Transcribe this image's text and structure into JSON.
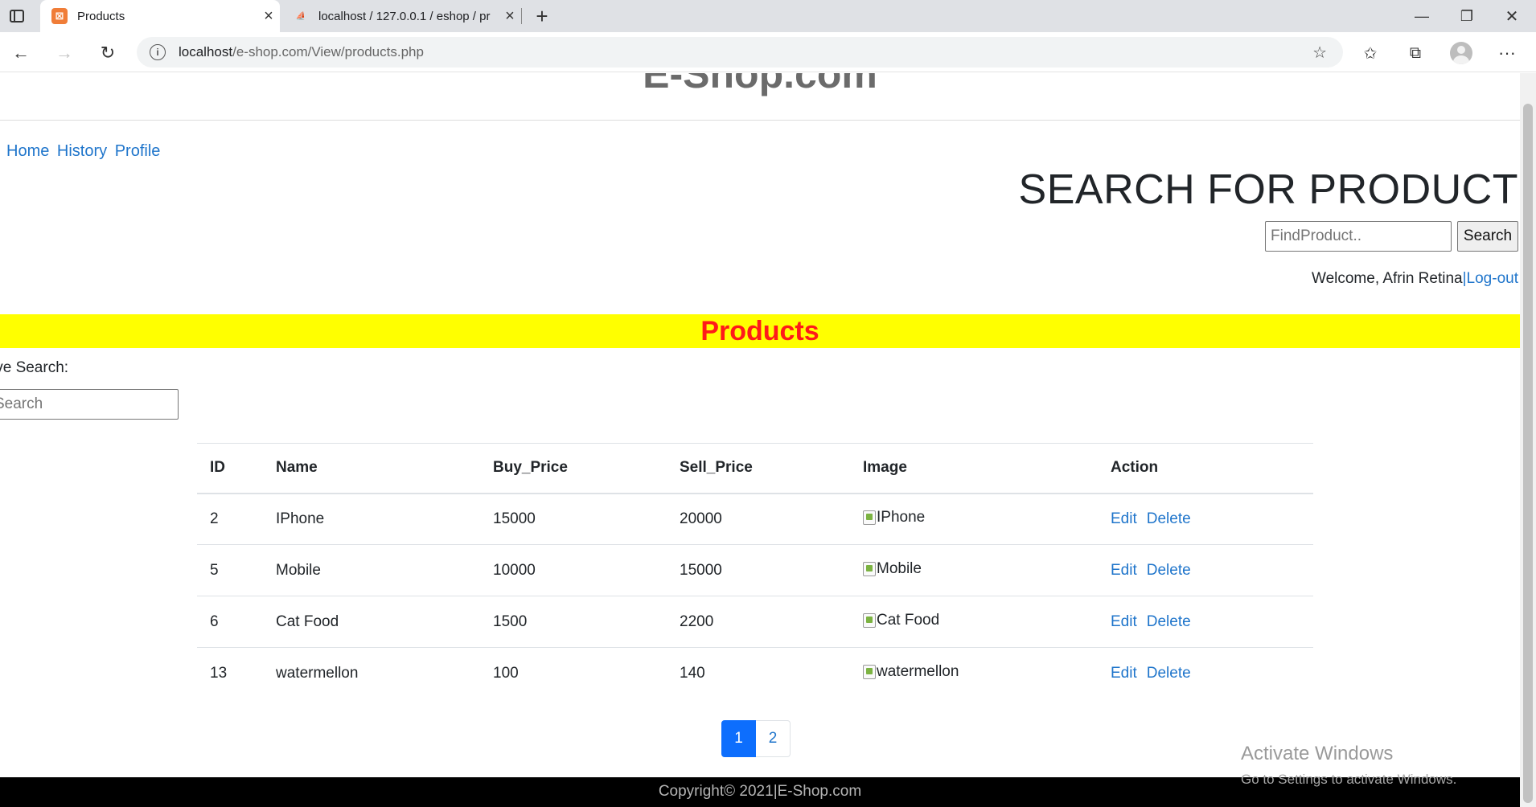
{
  "browser": {
    "tabs": [
      {
        "title": "Products",
        "favicon": "xampp-icon",
        "active": true
      },
      {
        "title": "localhost / 127.0.0.1 / eshop / pr",
        "favicon": "phpmyadmin-icon",
        "active": false
      }
    ],
    "url_host": "localhost",
    "url_path": "/e-shop.com/View/products.php"
  },
  "page": {
    "site_title": "E-Shop.com",
    "nav": [
      "Home",
      "History",
      "Profile"
    ],
    "search_heading": "SEARCH FOR PRODUCT",
    "find_placeholder": "FindProduct..",
    "search_button": "Search",
    "welcome_text": "Welcome, Afrin Retina",
    "separator": "|",
    "logout_label": "Log-out",
    "section_title": "Products",
    "live_search_label": "ive Search:",
    "live_search_placeholder": "Search",
    "table": {
      "headers": [
        "ID",
        "Name",
        "Buy_Price",
        "Sell_Price",
        "Image",
        "Action"
      ],
      "rows": [
        {
          "id": "2",
          "name": "IPhone",
          "buy": "15000",
          "sell": "20000",
          "image_alt": "IPhone"
        },
        {
          "id": "5",
          "name": "Mobile",
          "buy": "10000",
          "sell": "15000",
          "image_alt": "Mobile"
        },
        {
          "id": "6",
          "name": "Cat Food",
          "buy": "1500",
          "sell": "2200",
          "image_alt": "Cat Food"
        },
        {
          "id": "13",
          "name": "watermellon",
          "buy": "100",
          "sell": "140",
          "image_alt": "watermellon"
        }
      ],
      "edit_label": "Edit",
      "delete_label": "Delete"
    },
    "pagination": {
      "pages": [
        "1",
        "2"
      ],
      "current": "1"
    },
    "footer": "Copyright© 2021|E-Shop.com"
  },
  "os_watermark": {
    "title": "Activate Windows",
    "subtitle": "Go to Settings to activate Windows."
  },
  "colors": {
    "banner_bg": "#ffff00",
    "banner_text": "#ff1a1a",
    "link": "#1f75cb",
    "page_active": "#0d6efd",
    "footer_bg": "#000000"
  }
}
